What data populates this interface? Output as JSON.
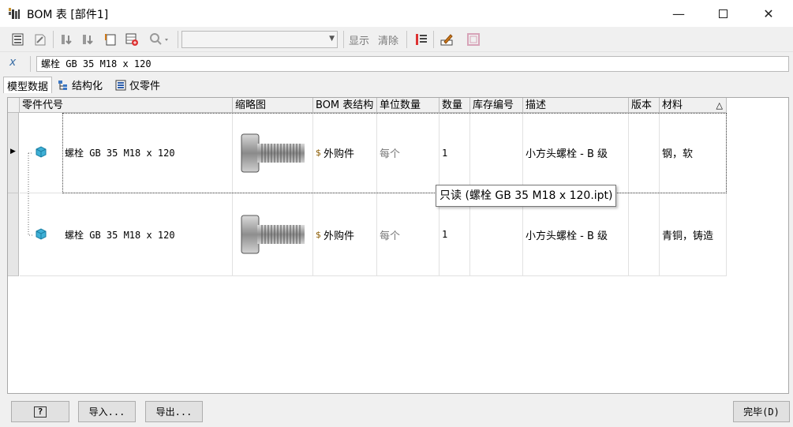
{
  "window": {
    "title": "BOM 表 [部件1]"
  },
  "toolbar": {
    "show_label": "显示",
    "clear_label": "清除",
    "combo_value": ""
  },
  "formula": {
    "fx_glyph": "x",
    "value": "螺栓 GB 35 M18 x 120"
  },
  "tabs": [
    {
      "label": "模型数据"
    },
    {
      "label": "结构化"
    },
    {
      "label": "仅零件"
    }
  ],
  "columns": [
    "零件代号",
    "缩略图",
    "BOM 表结构",
    "单位数量",
    "数量",
    "库存编号",
    "描述",
    "版本",
    "材料"
  ],
  "sort_indicator": "△",
  "rows": [
    {
      "part_number": "螺栓 GB 35 M18 x 120",
      "bom_structure": "外购件",
      "unit_qty": "每个",
      "qty": "1",
      "stock": "",
      "description": "小方头螺栓 - B 级",
      "revision": "",
      "material": "钢，软"
    },
    {
      "part_number": "螺栓 GB 35 M18 x 120",
      "bom_structure": "外购件",
      "unit_qty": "每个",
      "qty": "1",
      "stock": "",
      "description": "小方头螺栓 - B 级",
      "revision": "",
      "material": "青铜，铸造"
    }
  ],
  "tooltip": "只读 (螺栓 GB 35 M18 x 120.ipt)",
  "footer": {
    "help_label": "?",
    "import_label": "导入...",
    "export_label": "导出...",
    "done_label": "完毕(D)"
  }
}
